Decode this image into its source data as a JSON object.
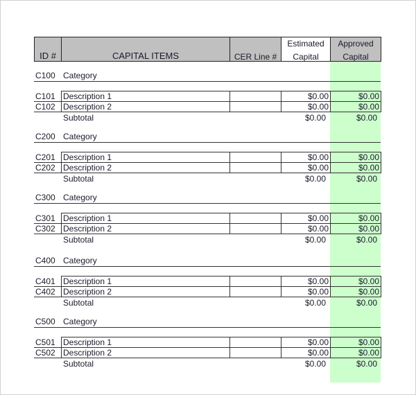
{
  "header": {
    "id": "ID #",
    "items": "CAPITAL ITEMS",
    "cer": "CER Line #",
    "estimated_1": "Estimated",
    "estimated_2": "Capital",
    "approved_1": "Approved",
    "approved_2": "Capital"
  },
  "colors": {
    "header_bg": "#c0c0c0",
    "approved_bg": "#ccffcc"
  },
  "sections": [
    {
      "id": "C100",
      "label": "Category",
      "items": [
        {
          "id": "C101",
          "desc": "Description 1",
          "cer": "",
          "est": "$0.00",
          "app": "$0.00"
        },
        {
          "id": "C102",
          "desc": "Description 2",
          "cer": "",
          "est": "$0.00",
          "app": "$0.00"
        }
      ],
      "subtotal_label": "Subtotal",
      "subtotal_est": "$0.00",
      "subtotal_app": "$0.00"
    },
    {
      "id": "C200",
      "label": "Category",
      "items": [
        {
          "id": "C201",
          "desc": "Description 1",
          "cer": "",
          "est": "$0.00",
          "app": "$0.00"
        },
        {
          "id": "C202",
          "desc": "Description 2",
          "cer": "",
          "est": "$0.00",
          "app": "$0.00"
        }
      ],
      "subtotal_label": "Subtotal",
      "subtotal_est": "$0.00",
      "subtotal_app": "$0.00"
    },
    {
      "id": "C300",
      "label": "Category",
      "items": [
        {
          "id": "C301",
          "desc": "Description 1",
          "cer": "",
          "est": "$0.00",
          "app": "$0.00"
        },
        {
          "id": "C302",
          "desc": "Description 2",
          "cer": "",
          "est": "$0.00",
          "app": "$0.00"
        }
      ],
      "subtotal_label": "Subtotal",
      "subtotal_est": "$0.00",
      "subtotal_app": "$0.00"
    },
    {
      "id": "C400",
      "label": "Category",
      "items": [
        {
          "id": "C401",
          "desc": "Description 1",
          "cer": "",
          "est": "$0.00",
          "app": "$0.00"
        },
        {
          "id": "C402",
          "desc": "Description 2",
          "cer": "",
          "est": "$0.00",
          "app": "$0.00"
        }
      ],
      "subtotal_label": "Subtotal",
      "subtotal_est": "$0.00",
      "subtotal_app": "$0.00"
    },
    {
      "id": "C500",
      "label": "Category",
      "items": [
        {
          "id": "C501",
          "desc": "Description 1",
          "cer": "",
          "est": "$0.00",
          "app": "$0.00"
        },
        {
          "id": "C502",
          "desc": "Description 2",
          "cer": "",
          "est": "$0.00",
          "app": "$0.00"
        }
      ],
      "subtotal_label": "Subtotal",
      "subtotal_est": "$0.00",
      "subtotal_app": "$0.00"
    }
  ]
}
